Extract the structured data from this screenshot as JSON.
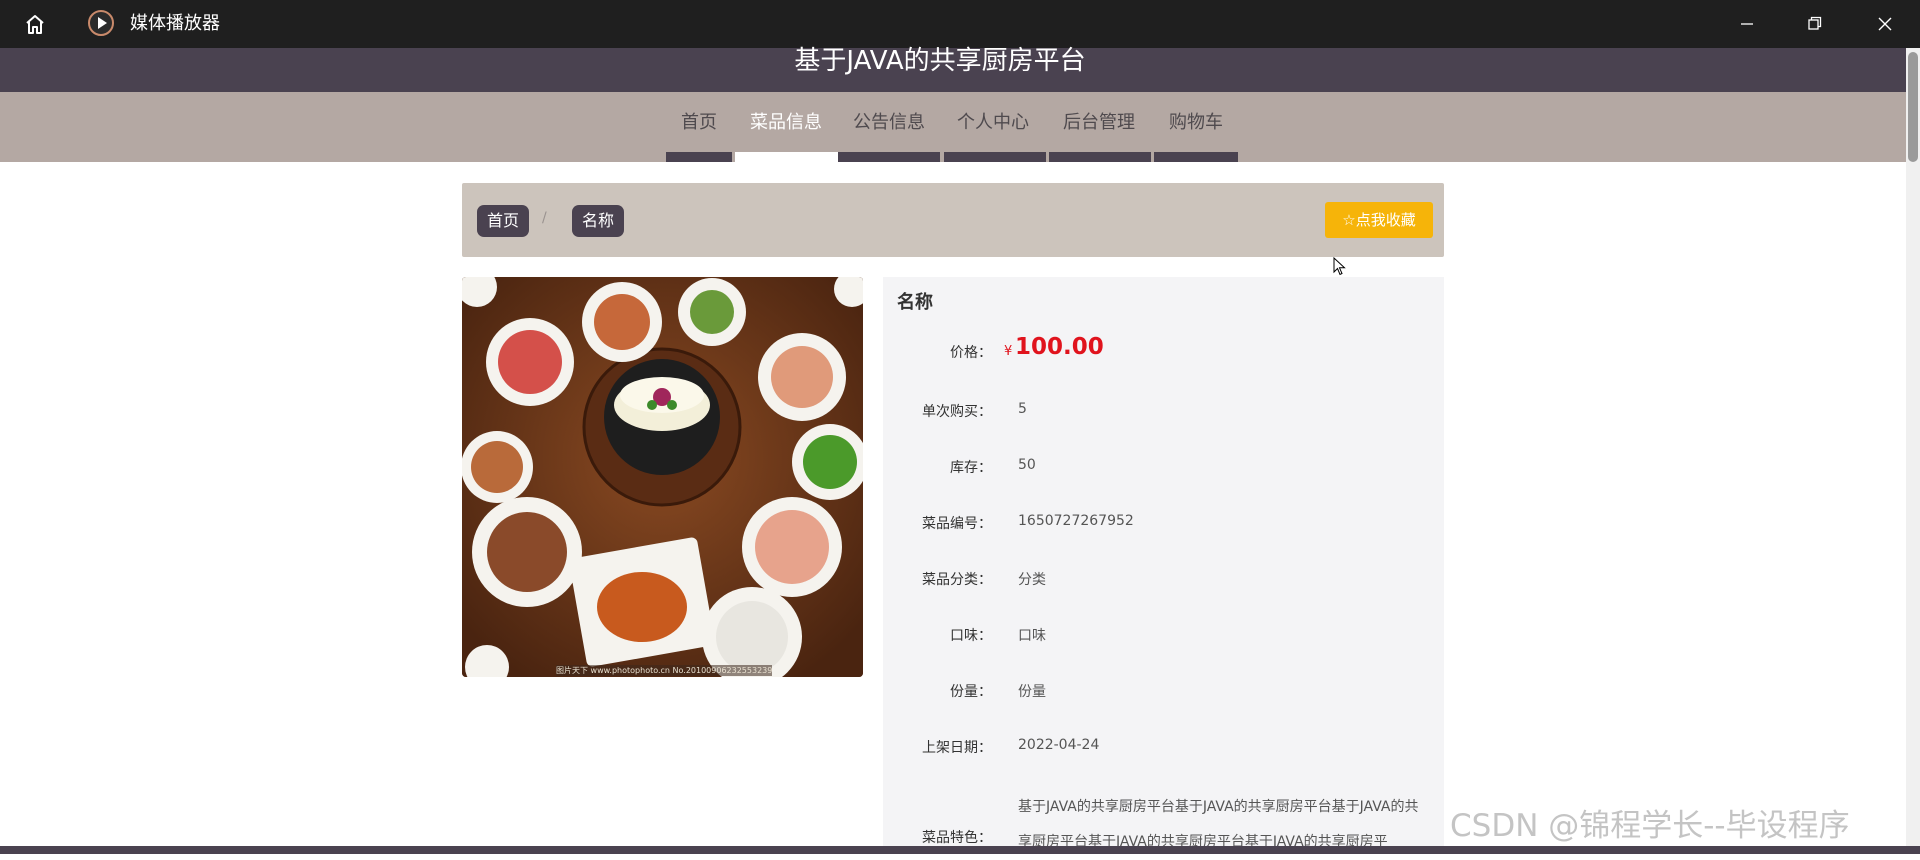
{
  "window": {
    "app_title": "媒体播放器"
  },
  "site": {
    "title": "基于JAVA的共享厨房平台",
    "nav": [
      "首页",
      "菜品信息",
      "公告信息",
      "个人中心",
      "后台管理",
      "购物车"
    ],
    "active_nav": "菜品信息"
  },
  "breadcrumb": {
    "home": "首页",
    "separator": "/",
    "current": "名称"
  },
  "favorite_button": "☆点我收藏",
  "image": {
    "caption": "图片天下 www.photophoto.cn  No.20100906232553239"
  },
  "product": {
    "name": "名称",
    "price_label": "价格：",
    "price_symbol": "¥",
    "price": "100.00",
    "fields": [
      {
        "label": "单次购买：",
        "value": "5"
      },
      {
        "label": "库存：",
        "value": "50"
      },
      {
        "label": "菜品编号：",
        "value": "1650727267952"
      },
      {
        "label": "菜品分类：",
        "value": "分类"
      },
      {
        "label": "口味：",
        "value": "口味"
      },
      {
        "label": "份量：",
        "value": "份量"
      },
      {
        "label": "上架日期：",
        "value": "2022-04-24"
      }
    ],
    "feature_label": "菜品特色：",
    "feature_text": "基于JAVA的共享厨房平台基于JAVA的共享厨房平台基于JAVA的共享厨房平台基于JAVA的共享厨房平台基于JAVA的共享厨房平"
  },
  "watermark": "CSDN @锦程学长--毕设程序",
  "colors": {
    "header": "#4a4250",
    "nav_bg": "#b4a8a3",
    "accent_button": "#f6b409",
    "price": "#e0131d"
  }
}
